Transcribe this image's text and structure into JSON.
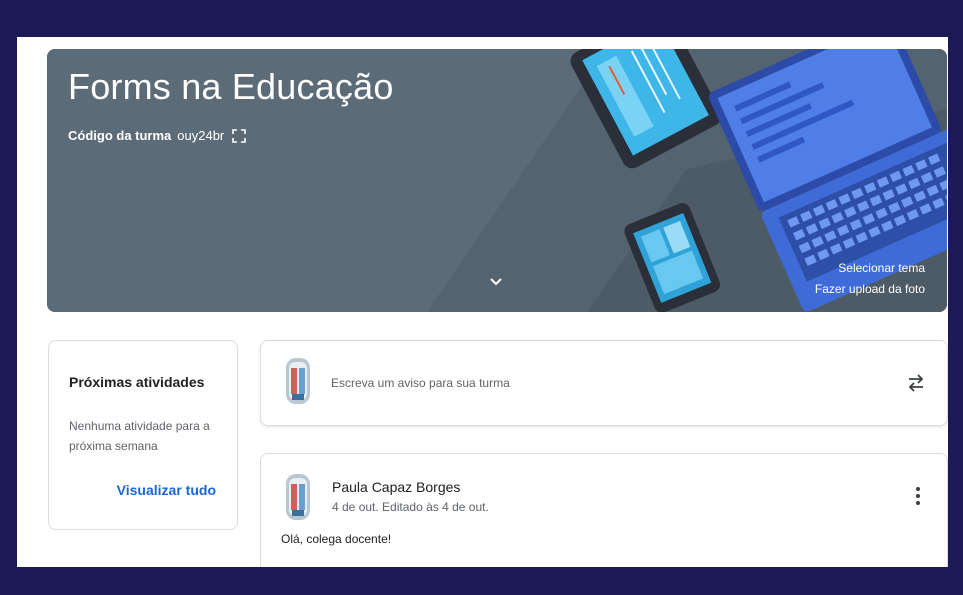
{
  "banner": {
    "title": "Forms na Educação",
    "class_code_label": "Código da turma",
    "class_code": "ouy24br",
    "select_theme": "Selecionar tema",
    "upload_photo": "Fazer upload da foto"
  },
  "upcoming": {
    "title": "Próximas atividades",
    "empty_text": "Nenhuma atividade para a próxima semana",
    "view_all": "Visualizar tudo"
  },
  "announce": {
    "placeholder": "Escreva um aviso para sua turma"
  },
  "post": {
    "author": "Paula Capaz Borges",
    "date": "4 de out. Editado às 4 de out.",
    "body": "Olá, colega docente!"
  },
  "colors": {
    "frame": "#1b1a57",
    "banner": "#5b6c78",
    "link": "#1967d2"
  }
}
